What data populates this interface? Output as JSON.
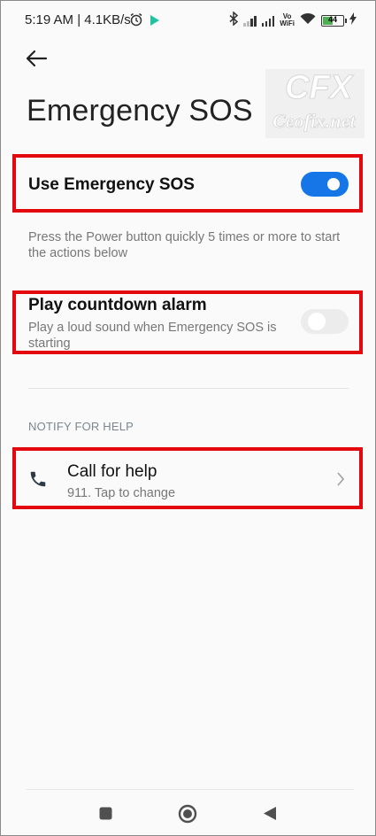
{
  "status_bar": {
    "time_speed": "5:19 AM | 4.1KB/s",
    "vowifi_top": "Vo",
    "vowifi_bottom": "WiFi",
    "battery": "44"
  },
  "header": {
    "title": "Emergency SOS"
  },
  "watermark": {
    "logo": "CFX",
    "text": "Ceofix.net"
  },
  "use_sos": {
    "label": "Use Emergency SOS",
    "enabled": true
  },
  "description": "Press the Power button quickly 5 times or more to start the actions below",
  "countdown": {
    "label": "Play countdown alarm",
    "subtitle": "Play a loud sound when Emergency SOS is starting",
    "enabled": false
  },
  "notify_section": {
    "header": "NOTIFY FOR HELP",
    "call": {
      "label": "Call for help",
      "subtitle": "911. Tap to change"
    }
  },
  "colors": {
    "accent": "#1676e8",
    "highlight": "#e3070e"
  },
  "icons": [
    "back-arrow-icon",
    "phone-icon",
    "chevron-right-icon",
    "alarm-icon",
    "play-icon",
    "bluetooth-icon",
    "wifi-icon",
    "battery-icon",
    "charging-icon",
    "recents-icon",
    "home-icon",
    "back-nav-icon"
  ]
}
